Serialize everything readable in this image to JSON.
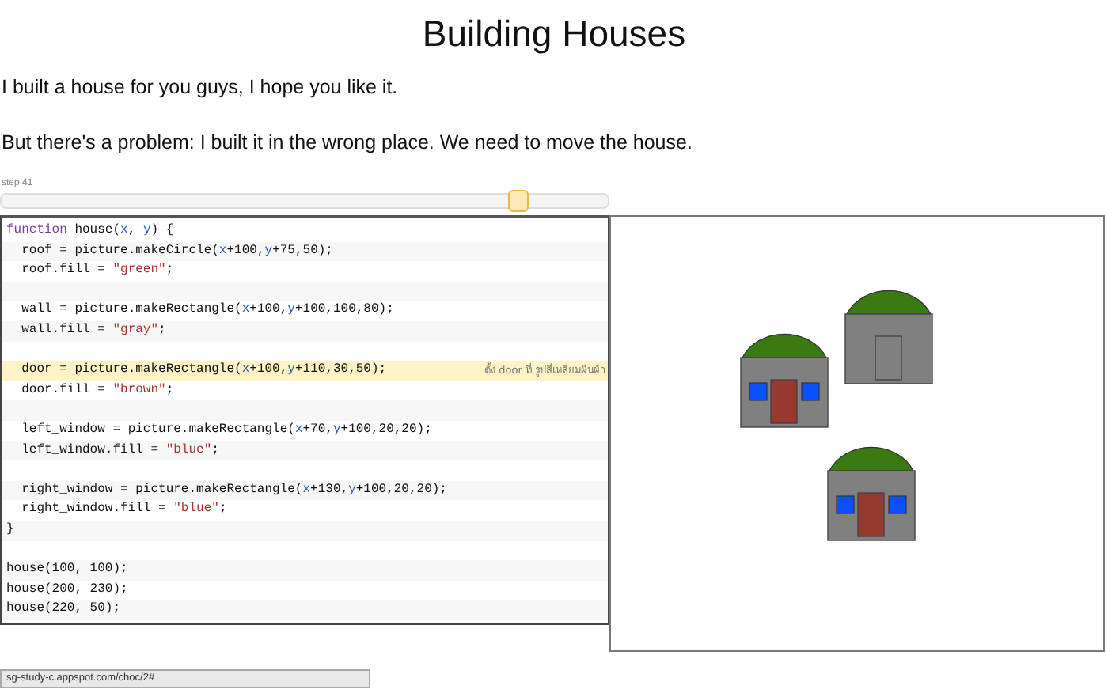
{
  "title": "Building Houses",
  "paragraphs": [
    "I built a house for you guys, I hope you like it.",
    "But there's a problem: I built it in the wrong place. We need to move the house."
  ],
  "stepper": {
    "label": "step 41",
    "level": 0.85
  },
  "code": [
    {
      "kind": "code",
      "highlighted": false,
      "tokens": [
        {
          "kind": "keyword",
          "t": "function"
        },
        {
          "kind": "plain",
          "t": " house("
        },
        {
          "kind": "var",
          "t": "x"
        },
        {
          "kind": "plain",
          "t": ", "
        },
        {
          "kind": "var",
          "t": "y"
        },
        {
          "kind": "plain",
          "t": ") {"
        }
      ]
    },
    {
      "kind": "code",
      "highlighted": false,
      "tokens": [
        {
          "kind": "plain",
          "t": "  roof = picture.makeCircle("
        },
        {
          "kind": "var",
          "t": "x"
        },
        {
          "kind": "plain",
          "t": "+100,"
        },
        {
          "kind": "var",
          "t": "y"
        },
        {
          "kind": "plain",
          "t": "+75,50);"
        }
      ]
    },
    {
      "kind": "code",
      "highlighted": false,
      "tokens": [
        {
          "kind": "plain",
          "t": "  roof.fill = "
        },
        {
          "kind": "string",
          "t": "\"green\""
        },
        {
          "kind": "plain",
          "t": ";"
        }
      ]
    },
    {
      "kind": "blank",
      "highlighted": false
    },
    {
      "kind": "code",
      "highlighted": false,
      "tokens": [
        {
          "kind": "plain",
          "t": "  wall = picture.makeRectangle("
        },
        {
          "kind": "var",
          "t": "x"
        },
        {
          "kind": "plain",
          "t": "+100,"
        },
        {
          "kind": "var",
          "t": "y"
        },
        {
          "kind": "plain",
          "t": "+100,100,80);"
        }
      ]
    },
    {
      "kind": "code",
      "highlighted": false,
      "tokens": [
        {
          "kind": "plain",
          "t": "  wall.fill = "
        },
        {
          "kind": "string",
          "t": "\"gray\""
        },
        {
          "kind": "plain",
          "t": ";"
        }
      ]
    },
    {
      "kind": "blank",
      "highlighted": false
    },
    {
      "kind": "code",
      "highlighted": true,
      "note": "ตั้ง door ที่ รูปสี่เหลี่ยมผืนผ้า",
      "tokens": [
        {
          "kind": "plain",
          "t": "  door = picture.makeRectangle("
        },
        {
          "kind": "var",
          "t": "x"
        },
        {
          "kind": "plain",
          "t": "+100,"
        },
        {
          "kind": "var",
          "t": "y"
        },
        {
          "kind": "plain",
          "t": "+110,30,50);"
        }
      ]
    },
    {
      "kind": "code",
      "highlighted": false,
      "tokens": [
        {
          "kind": "plain",
          "t": "  door.fill = "
        },
        {
          "kind": "string",
          "t": "\"brown\""
        },
        {
          "kind": "plain",
          "t": ";"
        }
      ]
    },
    {
      "kind": "blank",
      "highlighted": false
    },
    {
      "kind": "code",
      "highlighted": false,
      "tokens": [
        {
          "kind": "plain",
          "t": "  left_window = picture.makeRectangle("
        },
        {
          "kind": "var",
          "t": "x"
        },
        {
          "kind": "plain",
          "t": "+70,"
        },
        {
          "kind": "var",
          "t": "y"
        },
        {
          "kind": "plain",
          "t": "+100,20,20);"
        }
      ]
    },
    {
      "kind": "code",
      "highlighted": false,
      "tokens": [
        {
          "kind": "plain",
          "t": "  left_window.fill = "
        },
        {
          "kind": "string",
          "t": "\"blue\""
        },
        {
          "kind": "plain",
          "t": ";"
        }
      ]
    },
    {
      "kind": "blank",
      "highlighted": false
    },
    {
      "kind": "code",
      "highlighted": false,
      "tokens": [
        {
          "kind": "plain",
          "t": "  right_window = picture.makeRectangle("
        },
        {
          "kind": "var",
          "t": "x"
        },
        {
          "kind": "plain",
          "t": "+130,"
        },
        {
          "kind": "var",
          "t": "y"
        },
        {
          "kind": "plain",
          "t": "+100,20,20);"
        }
      ]
    },
    {
      "kind": "code",
      "highlighted": false,
      "tokens": [
        {
          "kind": "plain",
          "t": "  right_window.fill = "
        },
        {
          "kind": "string",
          "t": "\"blue\""
        },
        {
          "kind": "plain",
          "t": ";"
        }
      ]
    },
    {
      "kind": "code",
      "highlighted": false,
      "tokens": [
        {
          "kind": "plain",
          "t": "}"
        }
      ]
    },
    {
      "kind": "blank",
      "highlighted": false
    },
    {
      "kind": "code",
      "highlighted": false,
      "tokens": [
        {
          "kind": "plain",
          "t": "house(100, 100);"
        }
      ]
    },
    {
      "kind": "code",
      "highlighted": false,
      "tokens": [
        {
          "kind": "plain",
          "t": "house(200, 230);"
        }
      ]
    },
    {
      "kind": "code",
      "highlighted": false,
      "tokens": [
        {
          "kind": "plain",
          "t": "house(220, 50);"
        }
      ]
    }
  ],
  "canvas": {
    "houses": [
      {
        "door_filled": true,
        "windows": true
      },
      {
        "door_filled": true,
        "windows": true
      },
      {
        "door_filled": false,
        "windows": false
      }
    ]
  },
  "status_url": "sg-study-c.appspot.com/choc/2#"
}
